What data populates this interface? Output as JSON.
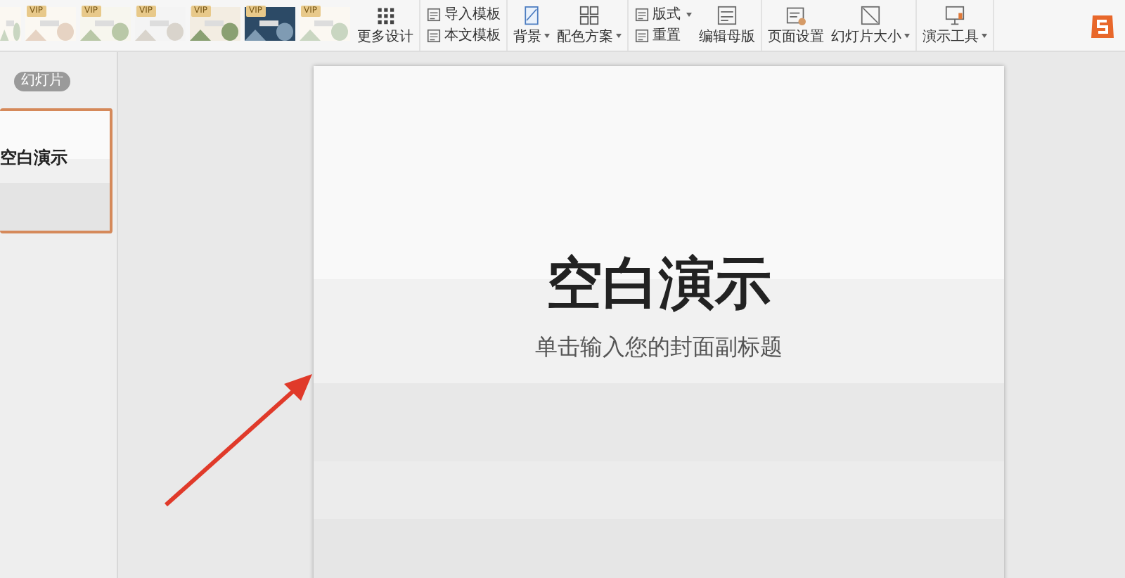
{
  "ribbon": {
    "templates": [
      {
        "kind": "picture"
      },
      {
        "kind": "picture",
        "badge": "VIP"
      },
      {
        "kind": "picture",
        "badge": "VIP"
      },
      {
        "kind": "picture",
        "badge": "VIP"
      },
      {
        "kind": "picture",
        "badge": "VIP"
      },
      {
        "kind": "picture",
        "badge": "VIP"
      },
      {
        "kind": "picture",
        "badge": "VIP"
      }
    ],
    "groups": [
      {
        "items": [
          {
            "kind": "large",
            "label": "更多设计",
            "dropdown": false
          }
        ]
      },
      {
        "items": [
          {
            "kind": "stack",
            "entries": [
              {
                "label": "导入模板",
                "dropdown": false
              },
              {
                "label": "本文模板",
                "dropdown": false
              }
            ]
          }
        ]
      },
      {
        "items": [
          {
            "kind": "large",
            "label": "背景",
            "dropdown": true
          },
          {
            "kind": "large",
            "label": "配色方案",
            "dropdown": true
          }
        ]
      },
      {
        "items": [
          {
            "kind": "stack",
            "entries": [
              {
                "label": "版式",
                "dropdown": true
              },
              {
                "label": "重置",
                "dropdown": false
              }
            ]
          },
          {
            "kind": "large",
            "label": "编辑母版",
            "dropdown": false
          }
        ]
      },
      {
        "items": [
          {
            "kind": "large",
            "label": "页面设置",
            "dropdown": false
          },
          {
            "kind": "large",
            "label": "幻灯片大小",
            "dropdown": true
          }
        ]
      },
      {
        "items": [
          {
            "kind": "large",
            "label": "演示工具",
            "dropdown": true
          }
        ]
      }
    ]
  },
  "panel": {
    "tab": {
      "label": "幻灯片",
      "selected": true
    },
    "thumbnails": [
      {
        "title": "空白演示",
        "selected": true
      }
    ]
  },
  "slide": {
    "title": "空白演示",
    "subtitle": "单击输入您的封面副标题"
  }
}
